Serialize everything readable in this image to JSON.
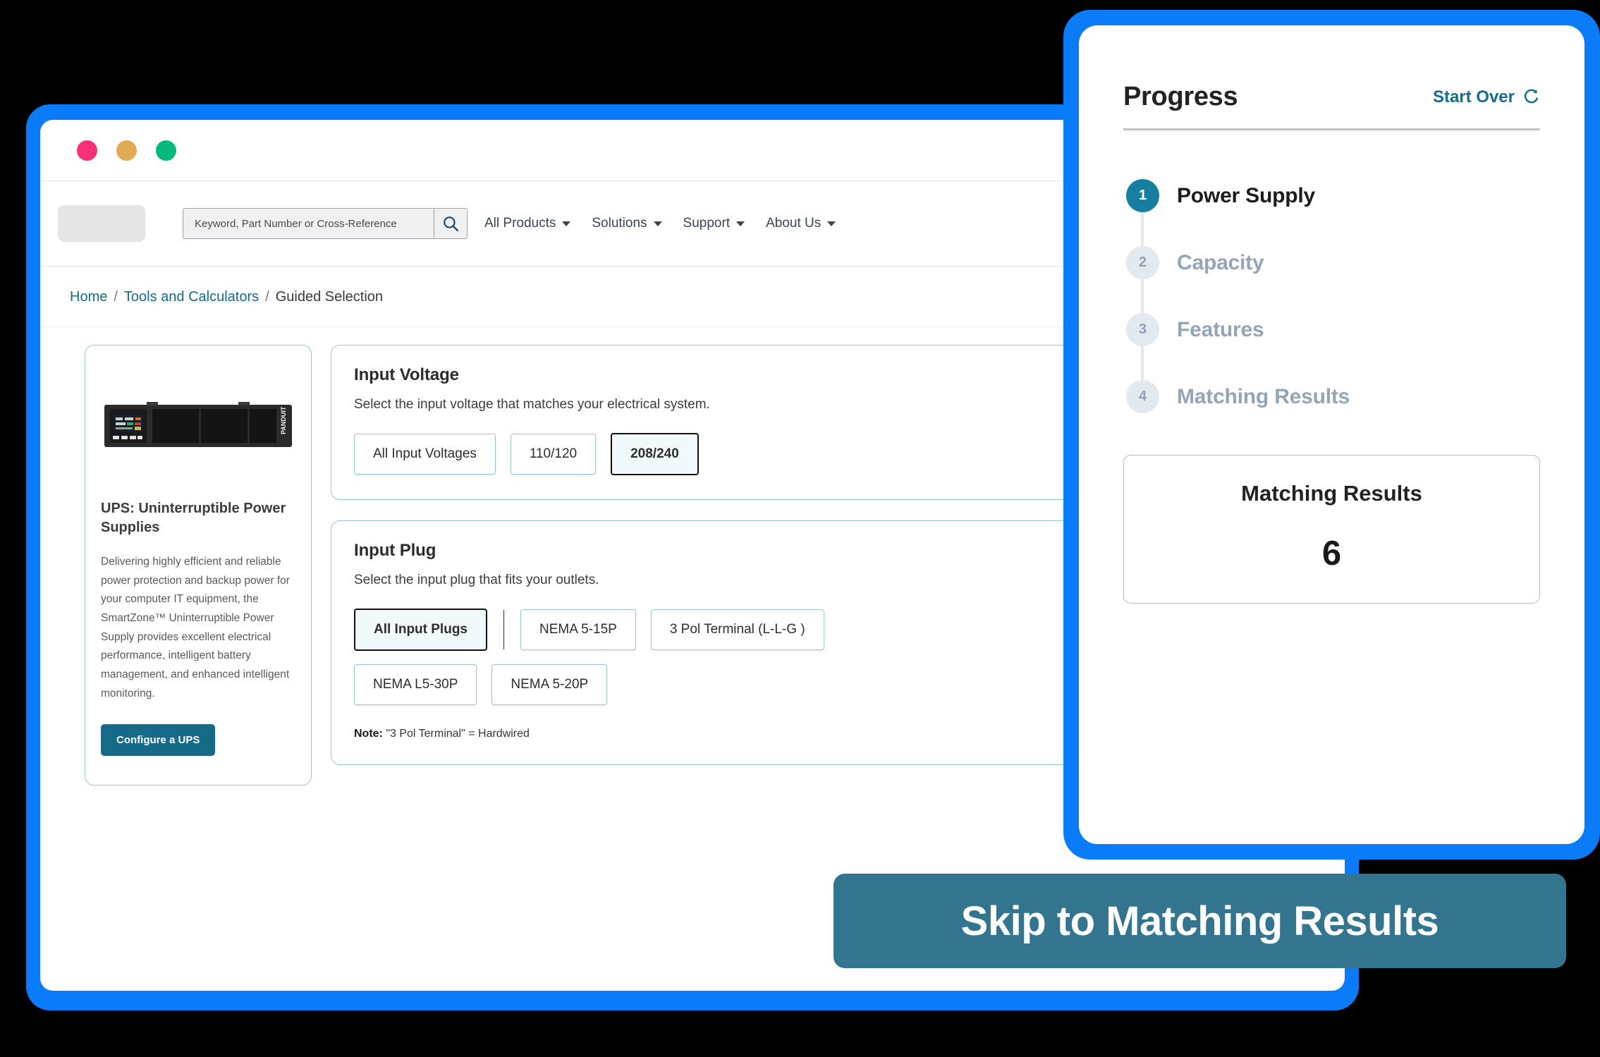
{
  "window": {
    "traffic_lights": [
      "close-red",
      "minimize-yellow",
      "maximize-green"
    ]
  },
  "header": {
    "search": {
      "placeholder": "Keyword, Part Number or Cross-Reference",
      "value": "",
      "button_icon": "search-icon"
    },
    "nav": [
      {
        "label": "All Products"
      },
      {
        "label": "Solutions"
      },
      {
        "label": "Support"
      },
      {
        "label": "About Us"
      }
    ]
  },
  "breadcrumb": {
    "items": [
      {
        "label": "Home",
        "link": true
      },
      {
        "label": "Tools and Calculators",
        "link": true
      },
      {
        "label": "Guided Selection",
        "link": false
      }
    ],
    "separator": "/"
  },
  "product_card": {
    "title": "UPS: Uninterruptible Power Supplies",
    "description": "Delivering highly efficient and reliable power protection and backup power for your computer IT equipment, the SmartZone™ Uninterruptible Power Supply provides excellent electrical performance, intelligent battery management, and enhanced intelligent monitoring.",
    "button_label": "Configure a UPS",
    "image_alt": "rack-mounted-ups-unit"
  },
  "questions": [
    {
      "id": "input-voltage",
      "title": "Input Voltage",
      "subtitle": "Select the input voltage that matches your electrical system.",
      "options": [
        {
          "label": "All Input Voltages",
          "selected": false
        },
        {
          "label": "110/120",
          "selected": false
        },
        {
          "label": "208/240",
          "selected": true
        }
      ],
      "note": ""
    },
    {
      "id": "input-plug",
      "title": "Input Plug",
      "subtitle": "Select the input plug that fits your outlets.",
      "options_row1": [
        {
          "label": "All Input Plugs",
          "selected": true
        },
        {
          "label": "NEMA 5-15P",
          "selected": false
        },
        {
          "label": "3 Pol Terminal (L-L-G )",
          "selected": false
        }
      ],
      "options_row2": [
        {
          "label": "NEMA L5-30P",
          "selected": false
        },
        {
          "label": "NEMA 5-20P",
          "selected": false
        }
      ],
      "note_prefix": "Note:",
      "note_text": " \"3 Pol Terminal\" = Hardwired"
    }
  ],
  "progress": {
    "title": "Progress",
    "start_over_label": "Start Over",
    "start_over_icon": "refresh-icon",
    "steps": [
      {
        "number": "1",
        "label": "Power Supply",
        "state": "active"
      },
      {
        "number": "2",
        "label": "Capacity",
        "state": "idle"
      },
      {
        "number": "3",
        "label": "Features",
        "state": "idle"
      },
      {
        "number": "4",
        "label": "Matching Results",
        "state": "idle"
      }
    ],
    "results": {
      "title": "Matching Results",
      "count": "6"
    }
  },
  "skip_banner": {
    "label": "Skip to Matching Results"
  },
  "colors": {
    "frame_blue": "#0a7cfa",
    "brand_teal": "#146a87",
    "step_active": "#167fa0",
    "banner": "#33748f",
    "card_border": "#9bc4d1",
    "link": "#17678f"
  }
}
